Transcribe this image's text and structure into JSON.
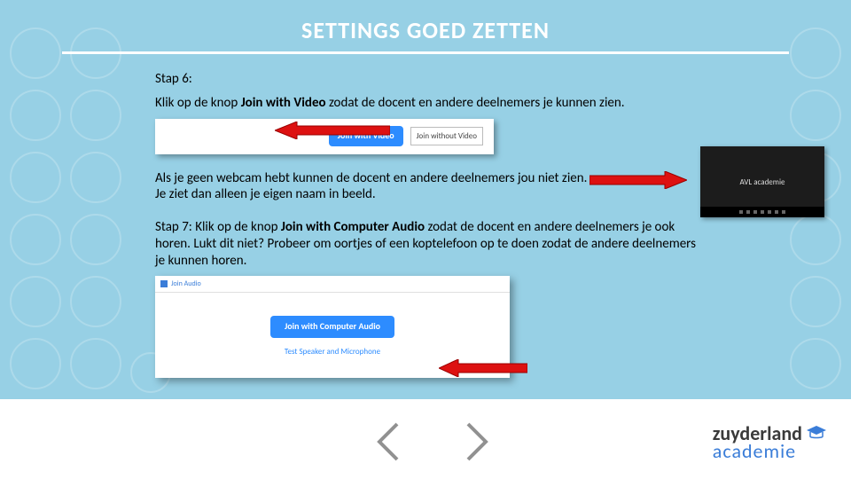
{
  "title": "SETTINGS GOED ZETTEN",
  "step6": {
    "heading": "Stap 6:",
    "line1a": "Klik op de knop ",
    "bold1": "Join with Video",
    "line1b": " zodat de docent en andere  deelnemers je kunnen zien."
  },
  "video_panel": {
    "join_with_video": "Join with Video",
    "join_without_video": "Join without Video"
  },
  "step6b": "Als je geen webcam hebt kunnen de docent en andere deelnemers jou niet zien. Je ziet dan alleen je eigen naam in beeld.",
  "zoom_tile_name": "AVL academie",
  "step7": {
    "prefix": "Stap 7: Klik op de knop ",
    "bold": "Join with Computer Audio",
    "rest": " zodat de docent en andere deelnemers je ook horen. Lukt dit niet? Probeer om oortjes of een koptelefoon op te doen zodat de andere deelnemers je kunnen horen."
  },
  "audio_dialog": {
    "title": "Join Audio",
    "button": "Join with Computer Audio",
    "link": "Test Speaker and Microphone"
  },
  "logo": {
    "top": "zuyderland",
    "bottom": "academie"
  }
}
